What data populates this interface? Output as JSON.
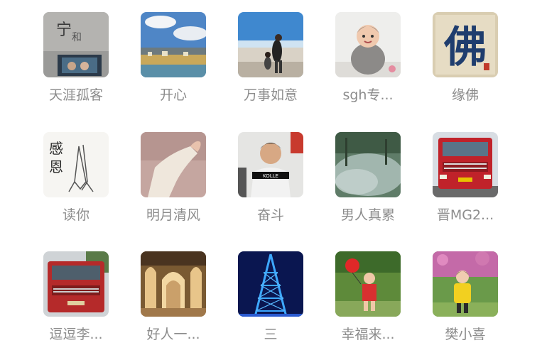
{
  "contacts": [
    {
      "name": "天涯孤客",
      "icon": "calligraphy-photo-avatar"
    },
    {
      "name": "开心",
      "icon": "landscape-avatar"
    },
    {
      "name": "万事如意",
      "icon": "people-at-sky-avatar"
    },
    {
      "name": "sgh专...",
      "icon": "baby-avatar"
    },
    {
      "name": "缘佛",
      "icon": "buddha-calligraphy-avatar"
    },
    {
      "name": "读你",
      "icon": "praying-hands-avatar"
    },
    {
      "name": "明月清风",
      "icon": "hand-avatar"
    },
    {
      "name": "奋斗",
      "icon": "man-portrait-avatar"
    },
    {
      "name": "男人真累",
      "icon": "misty-forest-avatar"
    },
    {
      "name": "晋MG2...",
      "icon": "red-truck-avatar"
    },
    {
      "name": "逗逗李...",
      "icon": "red-truck-avatar"
    },
    {
      "name": "好人一...",
      "icon": "church-interior-avatar"
    },
    {
      "name": "三",
      "icon": "blue-tower-avatar"
    },
    {
      "name": "幸福来...",
      "icon": "child-with-balloon-avatar"
    },
    {
      "name": "樊小喜",
      "icon": "girl-in-garden-avatar"
    }
  ]
}
